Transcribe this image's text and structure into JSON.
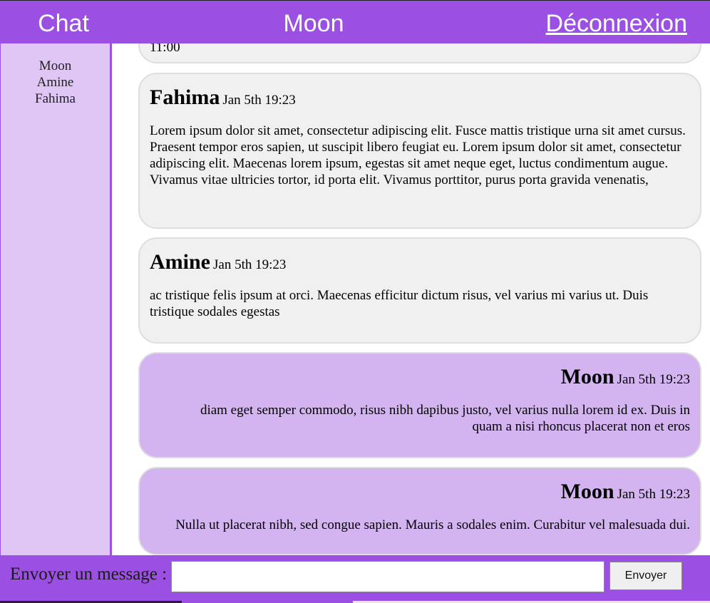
{
  "header": {
    "app_title": "Chat",
    "channel_title": "Moon",
    "logout_label": "Déconnexion"
  },
  "sidebar": {
    "users": [
      "Moon",
      "Amine",
      "Fahima"
    ]
  },
  "messages": [
    {
      "author": "",
      "time": "",
      "text": "11:00",
      "mine": false
    },
    {
      "author": "Fahima",
      "time": "Jan 5th 19:23",
      "text": "Lorem ipsum dolor sit amet, consectetur adipiscing elit. Fusce mattis tristique urna sit amet cursus. Praesent tempor eros sapien, ut suscipit libero feugiat eu. Lorem ipsum dolor sit amet, consectetur adipiscing elit. Maecenas lorem ipsum, egestas sit amet neque eget, luctus condimentum augue. Vivamus vitae ultricies tortor, id porta elit. Vivamus porttitor, purus porta gravida venenatis,",
      "mine": false
    },
    {
      "author": "Amine",
      "time": "Jan 5th 19:23",
      "text": "ac tristique felis ipsum at orci. Maecenas efficitur dictum risus, vel varius mi varius ut. Duis tristique sodales egestas",
      "mine": false
    },
    {
      "author": "Moon",
      "time": "Jan 5th 19:23",
      "text": "diam eget semper commodo, risus nibh dapibus justo, vel varius nulla lorem id ex. Duis in quam a nisi rhoncus placerat non et eros",
      "mine": true
    },
    {
      "author": "Moon",
      "time": "Jan 5th 19:23",
      "text": "Nulla ut placerat nibh, sed congue sapien. Mauris a sodales enim. Curabitur vel malesuada dui.",
      "mine": true
    }
  ],
  "composer": {
    "label": "Envoyer un message :",
    "input_value": "",
    "send_label": "Envoyer"
  },
  "colors": {
    "accent": "#9b4fe3",
    "sidebar_bg": "#dfc6f5",
    "own_message_bg": "#d3b4f1",
    "other_message_bg": "#f0f0f0"
  }
}
